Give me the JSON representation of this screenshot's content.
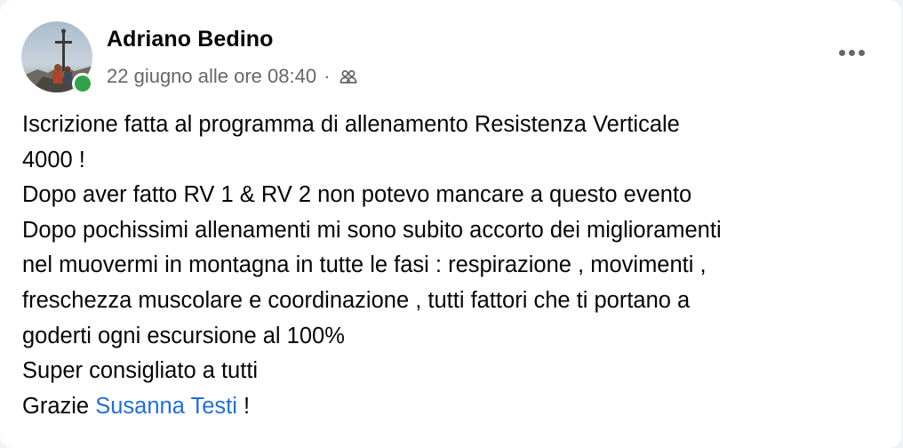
{
  "post": {
    "author": {
      "name": "Adriano Bedino",
      "online": true,
      "avatar_icon": "profile-photo-summit-cross"
    },
    "timestamp": "22 giugno alle ore 08:40",
    "separator": "·",
    "audience_icon": "friends-icon",
    "more_icon": "more-options-icon",
    "body": {
      "line1": "Iscrizione fatta al programma di allenamento Resistenza Verticale",
      "line2": "4000 !",
      "line3": "Dopo aver fatto RV 1 & RV 2 non potevo mancare a questo evento",
      "line4": "Dopo pochissimi allenamenti mi sono subito accorto dei miglioramenti",
      "line5": "nel muovermi in montagna in tutte le fasi : respirazione , movimenti ,",
      "line6": "freschezza muscolare e coordinazione , tutti fattori che ti portano a",
      "line7": "goderti ogni escursione al 100%",
      "line8": "Super consigliato a tutti",
      "line9_prefix": "Grazie ",
      "mention": "Susanna Testi",
      "line9_suffix": " !"
    },
    "colors": {
      "mention": "#216fdb",
      "online_dot": "#31a24c",
      "secondary_text": "#65676b",
      "primary_text": "#050505"
    }
  }
}
